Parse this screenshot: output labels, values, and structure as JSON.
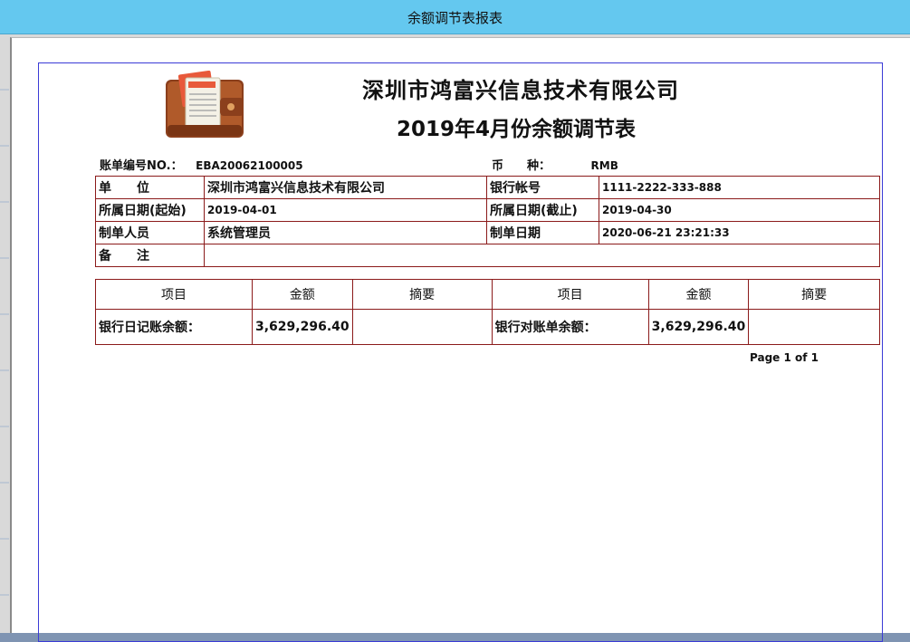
{
  "window": {
    "title": "余额调节表报表"
  },
  "report": {
    "company": "深圳市鸿富兴信息技术有限公司",
    "title": "2019年4月份余额调节表",
    "bill_no_label": "账单编号NO.：",
    "bill_no": "EBA20062100005",
    "currency_label": "币　　种：",
    "currency": "RMB",
    "info": {
      "unit_label": "单　　位",
      "unit": "深圳市鸿富兴信息技术有限公司",
      "account_label": "银行帐号",
      "account": "1111-2222-333-888",
      "start_label": "所属日期(起始)",
      "start": "2019-04-01",
      "end_label": "所属日期(截止)",
      "end": "2019-04-30",
      "maker_label": "制单人员",
      "maker": "系统管理员",
      "made_date_label": "制单日期",
      "made_date": "2020-06-21 23:21:33",
      "remark_label": "备　　注",
      "remark": ""
    },
    "detail": {
      "headers": [
        "项目",
        "金额",
        "摘要",
        "项目",
        "金额",
        "摘要"
      ],
      "row": {
        "left_item": "银行日记账余额：",
        "left_amount": "3,629,296.40",
        "left_summary": "",
        "right_item": "银行对账单余额：",
        "right_amount": "3,629,296.40",
        "right_summary": ""
      }
    },
    "page_no": "Page 1 of 1"
  },
  "colors": {
    "titlebar": "#64c8ef",
    "table_border": "#8b1a1a",
    "page_border": "#3b3bd6"
  },
  "icons": {
    "logo": "wallet-icon"
  }
}
